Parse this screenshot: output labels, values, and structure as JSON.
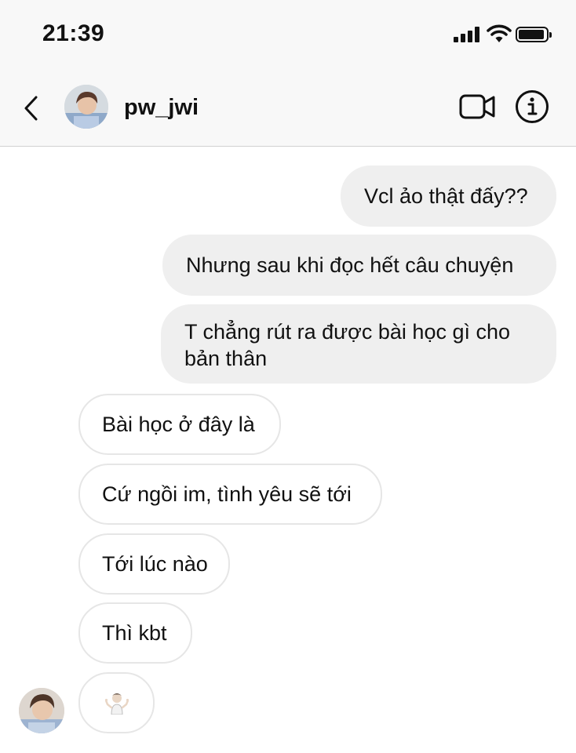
{
  "status_bar": {
    "time": "21:39"
  },
  "header": {
    "username": "pw_jwi",
    "icons": [
      "back-chevron-icon",
      "video-call-icon",
      "info-icon"
    ]
  },
  "messages": [
    {
      "side": "sent",
      "text": "Vcl ảo thật đấy??"
    },
    {
      "side": "sent",
      "text": "Nhưng sau khi đọc hết câu chuyện"
    },
    {
      "side": "sent",
      "text": "T chẳng rút ra được bài học gì cho bản thân"
    },
    {
      "side": "received",
      "text": "Bài học ở đây là"
    },
    {
      "side": "received",
      "text": "Cứ ngồi im, tình yêu sẽ tới"
    },
    {
      "side": "received",
      "text": "Tới lúc nào"
    },
    {
      "side": "received",
      "text": "Thì kbt"
    },
    {
      "side": "received",
      "emoji": "person-shrugging"
    }
  ],
  "colors": {
    "sent_bubble": "#efefef",
    "received_border": "#e6e6e6",
    "header_bg": "#f8f8f8"
  }
}
